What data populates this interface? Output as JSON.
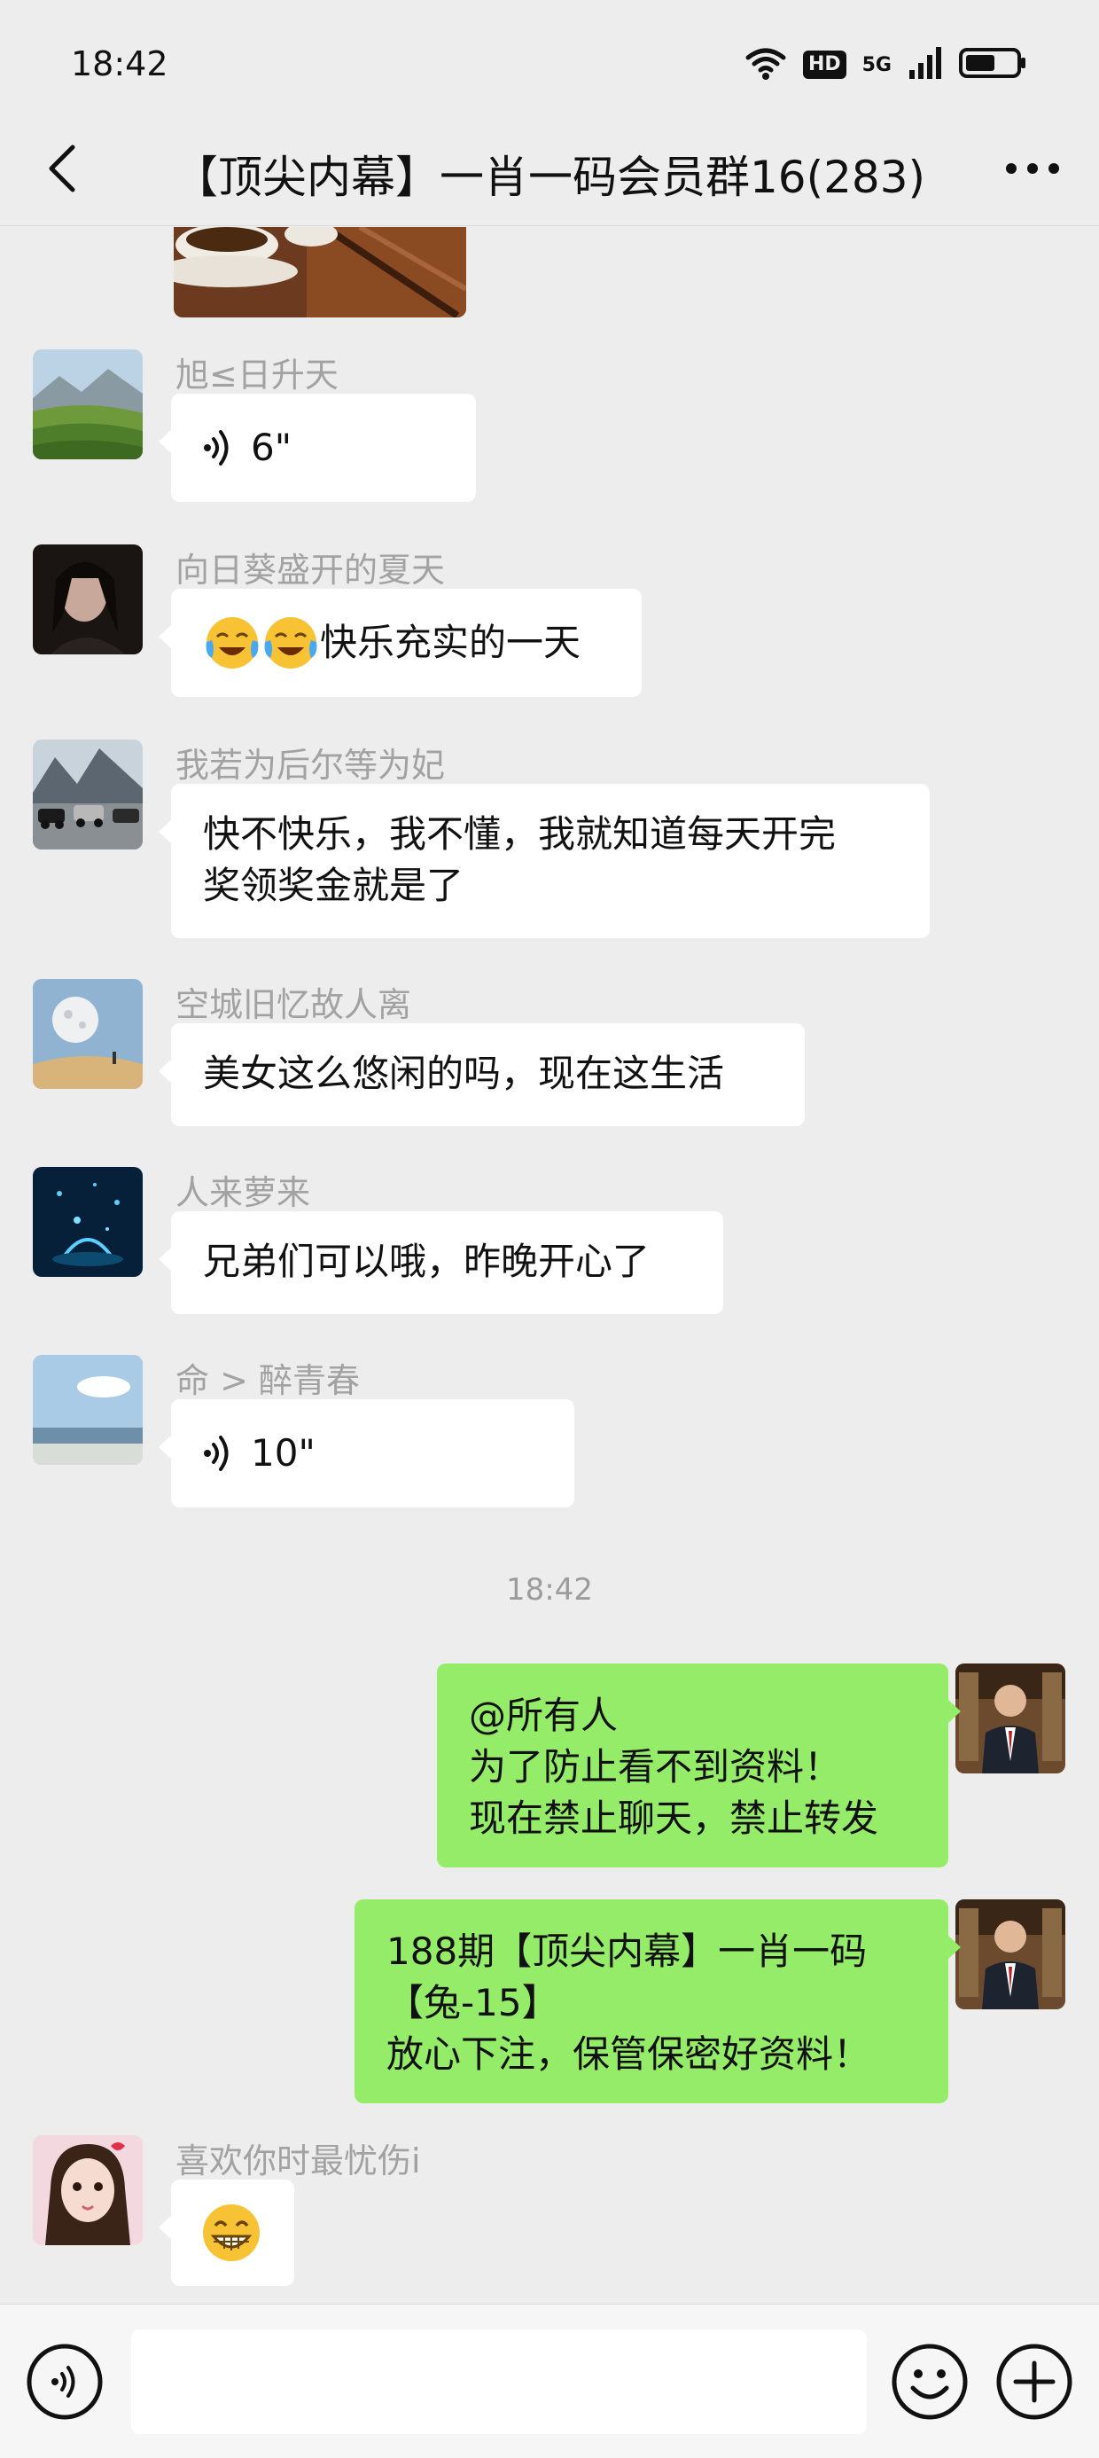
{
  "status_bar": {
    "time": "18:42",
    "hd": "HD",
    "network": "5G",
    "icons": [
      "wifi-icon",
      "signal-icon",
      "battery-icon"
    ]
  },
  "title_bar": {
    "title": "【顶尖内幕】一肖一码会员群16(283)",
    "back_icon": "back-arrow-icon",
    "more_icon": "more-dots-icon"
  },
  "messages": [
    {
      "sender": "旭≤日升天",
      "type": "voice",
      "duration": "6\""
    },
    {
      "sender": "向日葵盛开的夏天",
      "type": "text",
      "text": "快乐充实的一天"
    },
    {
      "sender": "我若为后尔等为妃",
      "type": "text",
      "lines": [
        "快不快乐，我不懂，我就知道每天开完",
        "奖领奖金就是了"
      ]
    },
    {
      "sender": "空城旧忆故人离",
      "type": "text",
      "text": "美女这么悠闲的吗，现在这生活"
    },
    {
      "sender": "人来萝来",
      "type": "text",
      "text": "兄弟们可以哦，昨晚开心了"
    },
    {
      "sender": "命 > 醉青春",
      "type": "voice",
      "duration": "10\""
    },
    {
      "sender": "喜欢你时最忧伤i",
      "type": "emoji"
    }
  ],
  "time_divider": "18:42",
  "outgoing": [
    {
      "lines": [
        "@所有人",
        "为了防止看不到资料！",
        "现在禁止聊天，禁止转发"
      ]
    },
    {
      "lines": [
        "188期【顶尖内幕】一肖一码",
        "【兔-15】",
        "放心下注，保管保密好资料！"
      ]
    }
  ],
  "input_bar": {
    "placeholder": "",
    "icons": [
      "voice-toggle-icon",
      "emoji-icon",
      "plus-icon"
    ]
  },
  "colors": {
    "background": "#ededed",
    "incoming_bubble": "#ffffff",
    "outgoing_bubble": "#95ec69",
    "sender_name": "#a2a2a2"
  }
}
